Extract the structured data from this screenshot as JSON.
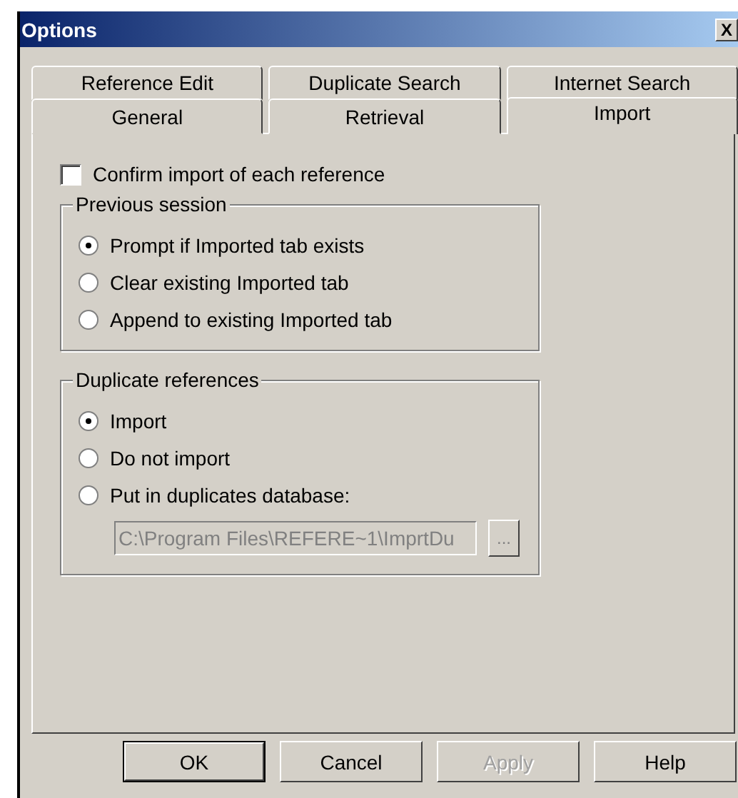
{
  "window": {
    "title": "Options",
    "close": "X"
  },
  "tab_rows": [
    [
      {
        "label": "Reference Edit",
        "selected": false
      },
      {
        "label": "Duplicate Search",
        "selected": false
      },
      {
        "label": "Internet Search",
        "selected": false
      }
    ],
    [
      {
        "label": "General",
        "selected": false
      },
      {
        "label": "Retrieval",
        "selected": false
      },
      {
        "label": "Import",
        "selected": true
      }
    ]
  ],
  "confirm": {
    "label": "Confirm import of each reference",
    "checked": false
  },
  "groups": [
    {
      "title": "Previous session",
      "options": [
        {
          "label": "Prompt if Imported tab exists",
          "selected": true
        },
        {
          "label": "Clear existing Imported tab",
          "selected": false
        },
        {
          "label": "Append to existing Imported tab",
          "selected": false
        }
      ]
    },
    {
      "title": "Duplicate references",
      "options": [
        {
          "label": "Import",
          "selected": true
        },
        {
          "label": "Do not import",
          "selected": false
        },
        {
          "label": "Put in duplicates database:",
          "selected": false
        }
      ],
      "path": {
        "value": "C:\\Program Files\\REFERE~1\\ImprtDu",
        "disabled": true,
        "browse": "..."
      }
    }
  ],
  "buttons": [
    {
      "label": "OK",
      "default": true,
      "disabled": false
    },
    {
      "label": "Cancel",
      "default": false,
      "disabled": false
    },
    {
      "label": "Apply",
      "default": false,
      "disabled": true
    },
    {
      "label": "Help",
      "default": false,
      "disabled": false
    }
  ]
}
